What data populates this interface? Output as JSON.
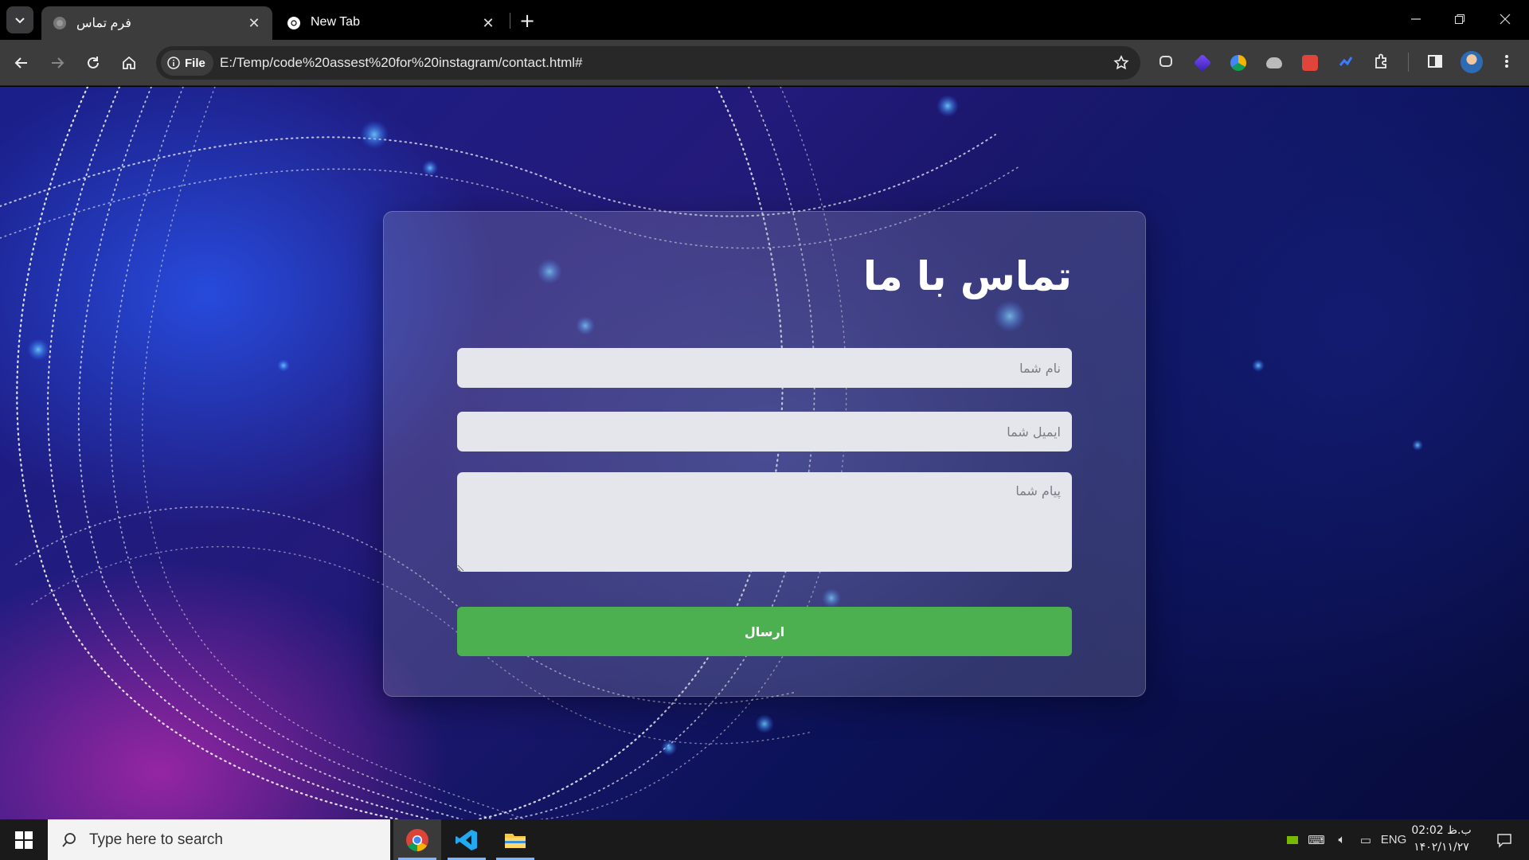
{
  "browser": {
    "tabs": [
      {
        "title": "فرم تماس",
        "active": true,
        "favicon": "globe-icon"
      },
      {
        "title": "New Tab",
        "active": false,
        "favicon": "chrome-icon"
      }
    ],
    "new_tab_label": "+",
    "address": {
      "chip_label": "File",
      "url": "E:/Temp/code%20assest%20for%20instagram/contact.html#"
    },
    "extensions": [
      "copilot-icon",
      "purple-cube-icon",
      "google-drive-icon",
      "cloud-icon",
      "red-stack-icon",
      "blue-arrow-icon",
      "puzzle-icon"
    ]
  },
  "page": {
    "title": "تماس با ما",
    "form": {
      "name_placeholder": "نام شما",
      "email_placeholder": "ایمیل شما",
      "message_placeholder": "پیام شما",
      "submit_label": "ارسال"
    }
  },
  "taskbar": {
    "search_placeholder": "Type here to search",
    "apps": [
      "chrome-icon",
      "vscode-icon",
      "file-explorer-icon"
    ],
    "language": "ENG",
    "time": "02:02 ب.ظ",
    "date": "۱۴۰۲/۱۱/۲۷"
  },
  "colors": {
    "submit_button": "#4caf50",
    "tab_active": "#3c3c3c",
    "toolbar": "#3c3c3c"
  }
}
